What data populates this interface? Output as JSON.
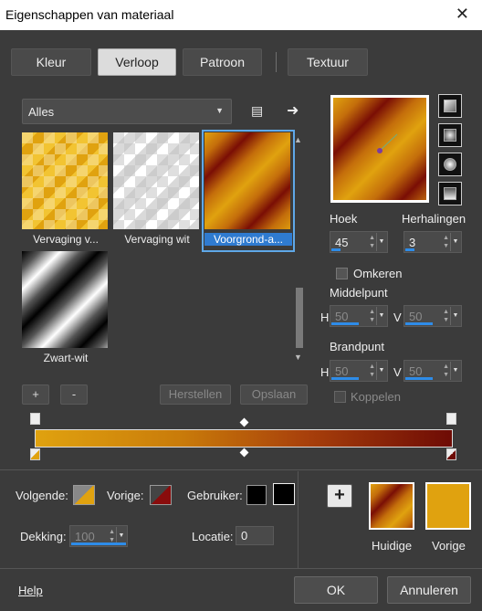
{
  "window": {
    "title": "Eigenschappen van materiaal",
    "close_glyph": "✕"
  },
  "tabs": [
    {
      "label": "Kleur",
      "active": false
    },
    {
      "label": "Verloop",
      "active": true
    },
    {
      "label": "Patroon",
      "active": false
    },
    {
      "label": "Textuur",
      "active": false
    }
  ],
  "category": {
    "value": "Alles"
  },
  "thumbnails": [
    {
      "label": "Vervaging v...",
      "selected": false
    },
    {
      "label": "Vervaging wit",
      "selected": false
    },
    {
      "label": "Voorgrond-a...",
      "selected": true
    },
    {
      "label": "Zwart-wit",
      "selected": false
    }
  ],
  "list_buttons": {
    "add": "+",
    "remove": "-",
    "reset": "Herstellen",
    "save": "Opslaan"
  },
  "angle": {
    "label": "Hoek",
    "value": "45"
  },
  "repeats": {
    "label": "Herhalingen",
    "value": "3"
  },
  "invert": {
    "label": "Omkeren",
    "checked": false
  },
  "center": {
    "label": "Middelpunt",
    "h_label": "H",
    "h_value": "50",
    "v_label": "V",
    "v_value": "50"
  },
  "focal": {
    "label": "Brandpunt",
    "h_label": "H",
    "h_value": "50",
    "v_label": "V",
    "v_value": "50"
  },
  "link": {
    "label": "Koppelen",
    "checked": false
  },
  "stops": {
    "next_label": "Volgende:",
    "prev_label": "Vorige:",
    "user_label": "Gebruiker:",
    "opacity_label": "Dekking:",
    "opacity_value": "100",
    "location_label": "Locatie:",
    "location_value": "0"
  },
  "current": {
    "label": "Huidige"
  },
  "previous": {
    "label": "Vorige"
  },
  "footer": {
    "help": "Help",
    "ok": "OK",
    "cancel": "Annuleren"
  },
  "colors": {
    "gold": "#e0a20f",
    "dark_red": "#6e0b05",
    "selection": "#2f7bd0"
  }
}
